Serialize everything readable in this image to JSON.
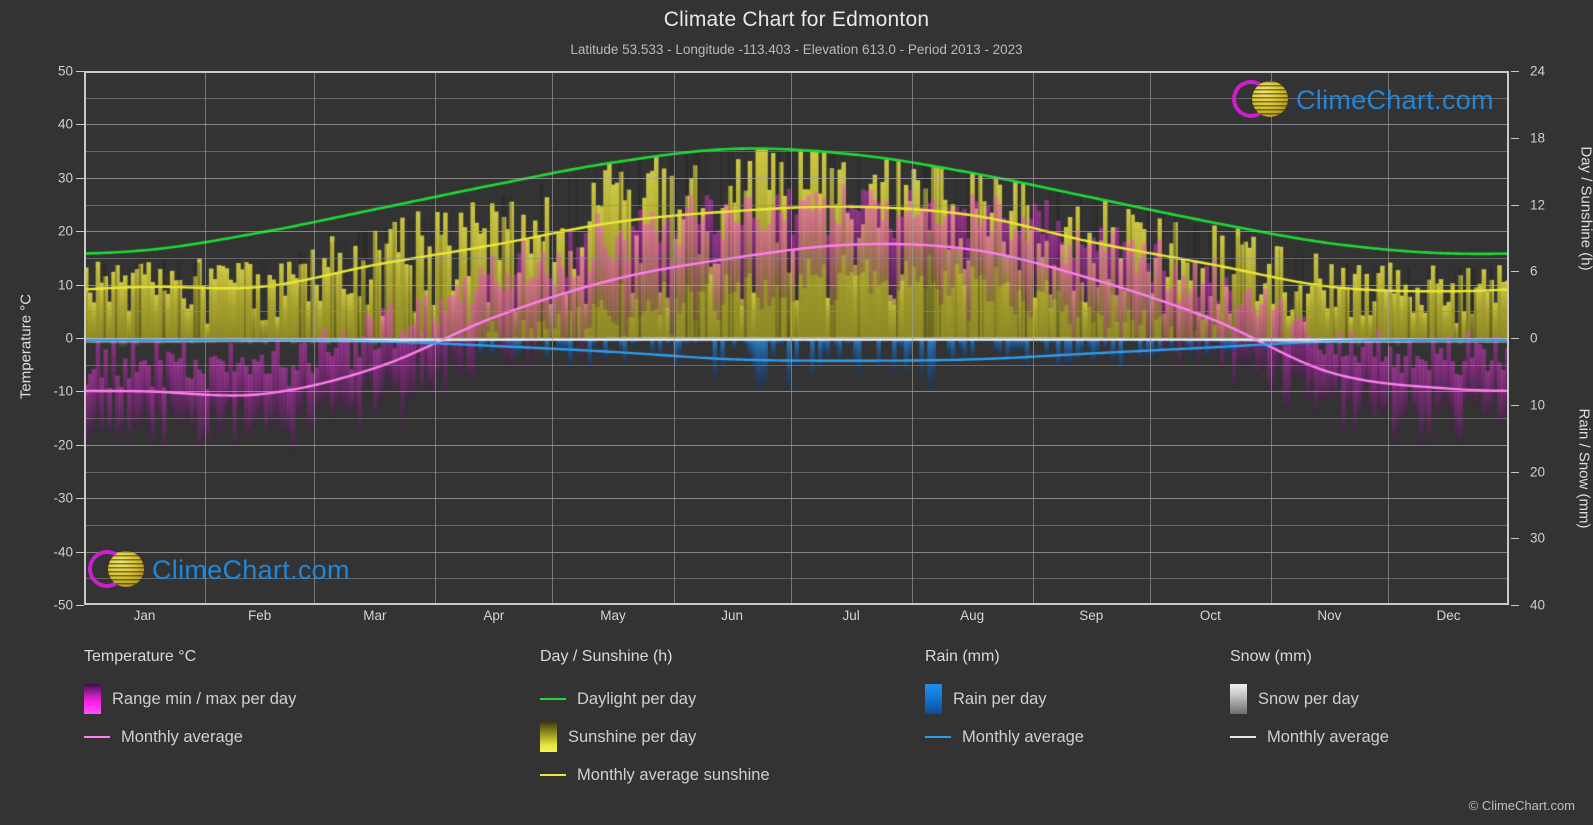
{
  "header": {
    "title": "Climate Chart for Edmonton",
    "subtitle": "Latitude 53.533 - Longitude -113.403 - Elevation 613.0 - Period 2013 - 2023"
  },
  "axes": {
    "left_title": "Temperature °C",
    "right_title_top": "Day / Sunshine (h)",
    "right_title_bottom": "Rain / Snow (mm)",
    "left_ticks": [
      "50",
      "40",
      "30",
      "20",
      "10",
      "0",
      "-10",
      "-20",
      "-30",
      "-40",
      "-50"
    ],
    "right_ticks_top": [
      "24",
      "18",
      "12",
      "6",
      "0"
    ],
    "right_ticks_bottom": [
      "10",
      "20",
      "30",
      "40"
    ],
    "x_ticks": [
      "Jan",
      "Feb",
      "Mar",
      "Apr",
      "May",
      "Jun",
      "Jul",
      "Aug",
      "Sep",
      "Oct",
      "Nov",
      "Dec"
    ]
  },
  "legend": {
    "groups": [
      {
        "title": "Temperature °C",
        "items": [
          {
            "label": "Range min / max per day",
            "kind": "box",
            "swatch": "sw-temp"
          },
          {
            "label": "Monthly average",
            "kind": "line",
            "color": "#ff7ff0"
          }
        ]
      },
      {
        "title": "Day / Sunshine (h)",
        "items": [
          {
            "label": "Daylight per day",
            "kind": "line",
            "color": "#1fd936"
          },
          {
            "label": "Sunshine per day",
            "kind": "box",
            "swatch": "sw-sun"
          },
          {
            "label": "Monthly average sunshine",
            "kind": "line",
            "color": "#ece737"
          }
        ]
      },
      {
        "title": "Rain (mm)",
        "items": [
          {
            "label": "Rain per day",
            "kind": "box",
            "swatch": "sw-rain"
          },
          {
            "label": "Monthly average",
            "kind": "line",
            "color": "#2e9ced"
          }
        ]
      },
      {
        "title": "Snow (mm)",
        "items": [
          {
            "label": "Snow per day",
            "kind": "box",
            "swatch": "sw-snow"
          },
          {
            "label": "Monthly average",
            "kind": "line",
            "color": "#e6e6e6"
          }
        ]
      }
    ]
  },
  "watermark": {
    "text": "ClimeChart.com"
  },
  "copyright": "© ClimeChart.com",
  "colors": {
    "background": "#333333",
    "grid": "#8e8e8e",
    "axis": "#c9c9c9",
    "temp_line": "#ff7ff0",
    "daylight_line": "#1fd936",
    "sunshine_line": "#ece737",
    "rain_line": "#2e9ced",
    "snow_line": "#e6e6e6",
    "zero_line": "#ffffff",
    "temp_bar": "#d21fd2",
    "sunshine_bar": "#c9c33a",
    "rain_bar": "#1f7fd0",
    "snow_bar": "#bdbdbd",
    "brand_blue": "#1f8ae0",
    "brand_magenta": "#d21fd2",
    "brand_yellow": "#ddc62e"
  },
  "chart_data": {
    "type": "area",
    "title": "Climate Chart for Edmonton",
    "subtitle": "Latitude 53.533 - Longitude -113.403 - Elevation 613.0 - Period 2013 - 2023",
    "location": "Edmonton",
    "latitude": 53.533,
    "longitude": -113.403,
    "elevation": 613.0,
    "period": "2013 - 2023",
    "xlabel": "",
    "ylabel": "Temperature °C",
    "ylabel_right_top": "Day / Sunshine (h)",
    "ylabel_right_bottom": "Rain / Snow (mm)",
    "ylim": [
      -50,
      50
    ],
    "ylim_right_day": [
      0,
      24
    ],
    "ylim_right_precip": [
      0,
      40
    ],
    "grid": true,
    "legend_position": "below",
    "categories": [
      "Jan",
      "Feb",
      "Mar",
      "Apr",
      "May",
      "Jun",
      "Jul",
      "Aug",
      "Sep",
      "Oct",
      "Nov",
      "Dec"
    ],
    "series": [
      {
        "name": "Monthly average temperature",
        "unit": "°C",
        "axis": "left",
        "color": "#ff7ff0",
        "values": [
          -10.0,
          -10.5,
          -5.5,
          4.0,
          11.0,
          15.0,
          17.5,
          16.5,
          11.0,
          3.5,
          -6.5,
          -9.5
        ]
      },
      {
        "name": "Monthly average sunshine",
        "unit": "h",
        "axis": "right_day",
        "color": "#ece737",
        "values": [
          4.6,
          4.6,
          6.6,
          8.4,
          10.4,
          11.4,
          11.8,
          11.0,
          8.6,
          6.6,
          4.6,
          4.2
        ]
      },
      {
        "name": "Daylight per day",
        "unit": "h",
        "axis": "right_day",
        "color": "#1fd936",
        "values": [
          7.9,
          9.5,
          11.6,
          13.8,
          15.8,
          17.0,
          16.5,
          14.8,
          12.6,
          10.4,
          8.5,
          7.6
        ]
      },
      {
        "name": "Monthly average rain",
        "unit": "mm",
        "axis": "right_precip",
        "color": "#2e9ced",
        "values": [
          0.3,
          0.3,
          0.5,
          1.2,
          2.1,
          3.2,
          3.4,
          3.2,
          2.3,
          1.4,
          0.5,
          0.3
        ]
      },
      {
        "name": "Monthly average snow",
        "unit": "mm",
        "axis": "right_precip",
        "color": "#e6e6e6",
        "values": [
          0.6,
          0.5,
          0.5,
          0.3,
          0.05,
          0.0,
          0.0,
          0.0,
          0.05,
          0.3,
          0.6,
          0.6
        ]
      },
      {
        "name": "Temperature range max per day",
        "unit": "°C",
        "axis": "left",
        "color": "#ff22e8",
        "values": [
          -5.0,
          -5.0,
          0.5,
          10.5,
          18.0,
          22.0,
          24.5,
          23.0,
          17.5,
          9.5,
          -1.5,
          -4.5
        ]
      },
      {
        "name": "Temperature range min per day",
        "unit": "°C",
        "axis": "left",
        "color": "#a31ea8",
        "values": [
          -15.5,
          -16.0,
          -11.5,
          -2.0,
          4.5,
          9.0,
          11.0,
          10.0,
          4.5,
          -2.0,
          -11.5,
          -15.0
        ]
      }
    ]
  }
}
